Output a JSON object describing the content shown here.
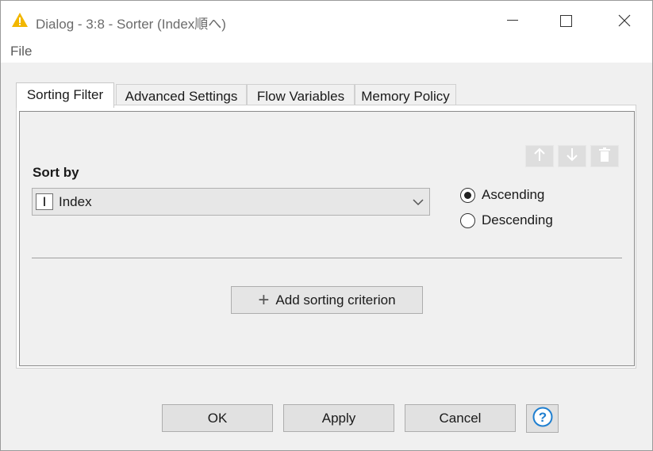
{
  "window": {
    "title": "Dialog - 3:8 - Sorter (Index順へ)",
    "icon": "warning-triangle-icon"
  },
  "menu": {
    "file": "File"
  },
  "tabs": [
    {
      "label": "Sorting Filter",
      "active": true
    },
    {
      "label": "Advanced Settings",
      "active": false
    },
    {
      "label": "Flow Variables",
      "active": false
    },
    {
      "label": "Memory Policy",
      "active": false
    }
  ],
  "sorting": {
    "sort_by_label": "Sort by",
    "column_type_glyph": "I",
    "selected_column": "Index",
    "order_options": [
      {
        "label": "Ascending",
        "selected": true
      },
      {
        "label": "Descending",
        "selected": false
      }
    ],
    "add_label": "Add sorting criterion"
  },
  "buttons": {
    "ok": "OK",
    "apply": "Apply",
    "cancel": "Cancel",
    "help": "?"
  },
  "colors": {
    "icon_warning": "#f2b700",
    "help_blue": "#1f7fd0"
  }
}
